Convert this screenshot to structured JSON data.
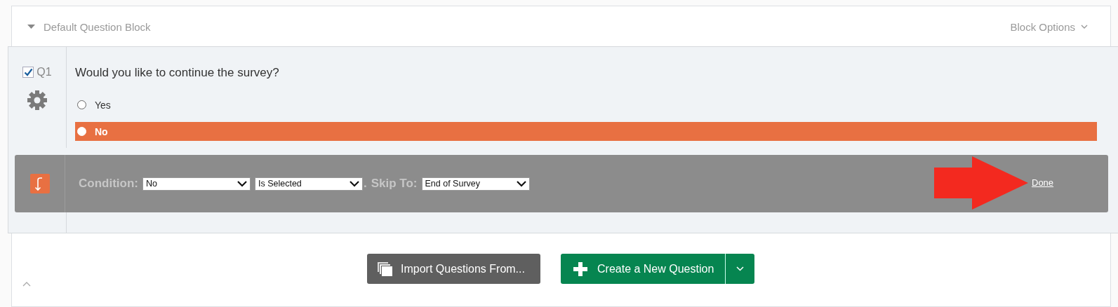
{
  "block": {
    "title": "Default Question Block",
    "options_label": "Block Options",
    "expanded": true
  },
  "question": {
    "number": "Q1",
    "checked": true,
    "text": "Would you like to continue the survey?",
    "choices": [
      {
        "label": "Yes",
        "selected": false
      },
      {
        "label": "No",
        "selected": true
      }
    ]
  },
  "skip_logic": {
    "condition_label": "Condition:",
    "selects": [
      "No",
      "Is Selected"
    ],
    "separator": ".",
    "skip_label": "Skip To:",
    "target": "End of Survey",
    "done": "Done"
  },
  "buttons": [
    {
      "kind": "import",
      "label": "Import Questions From..."
    },
    {
      "kind": "create",
      "label": "Create a New Question"
    }
  ]
}
